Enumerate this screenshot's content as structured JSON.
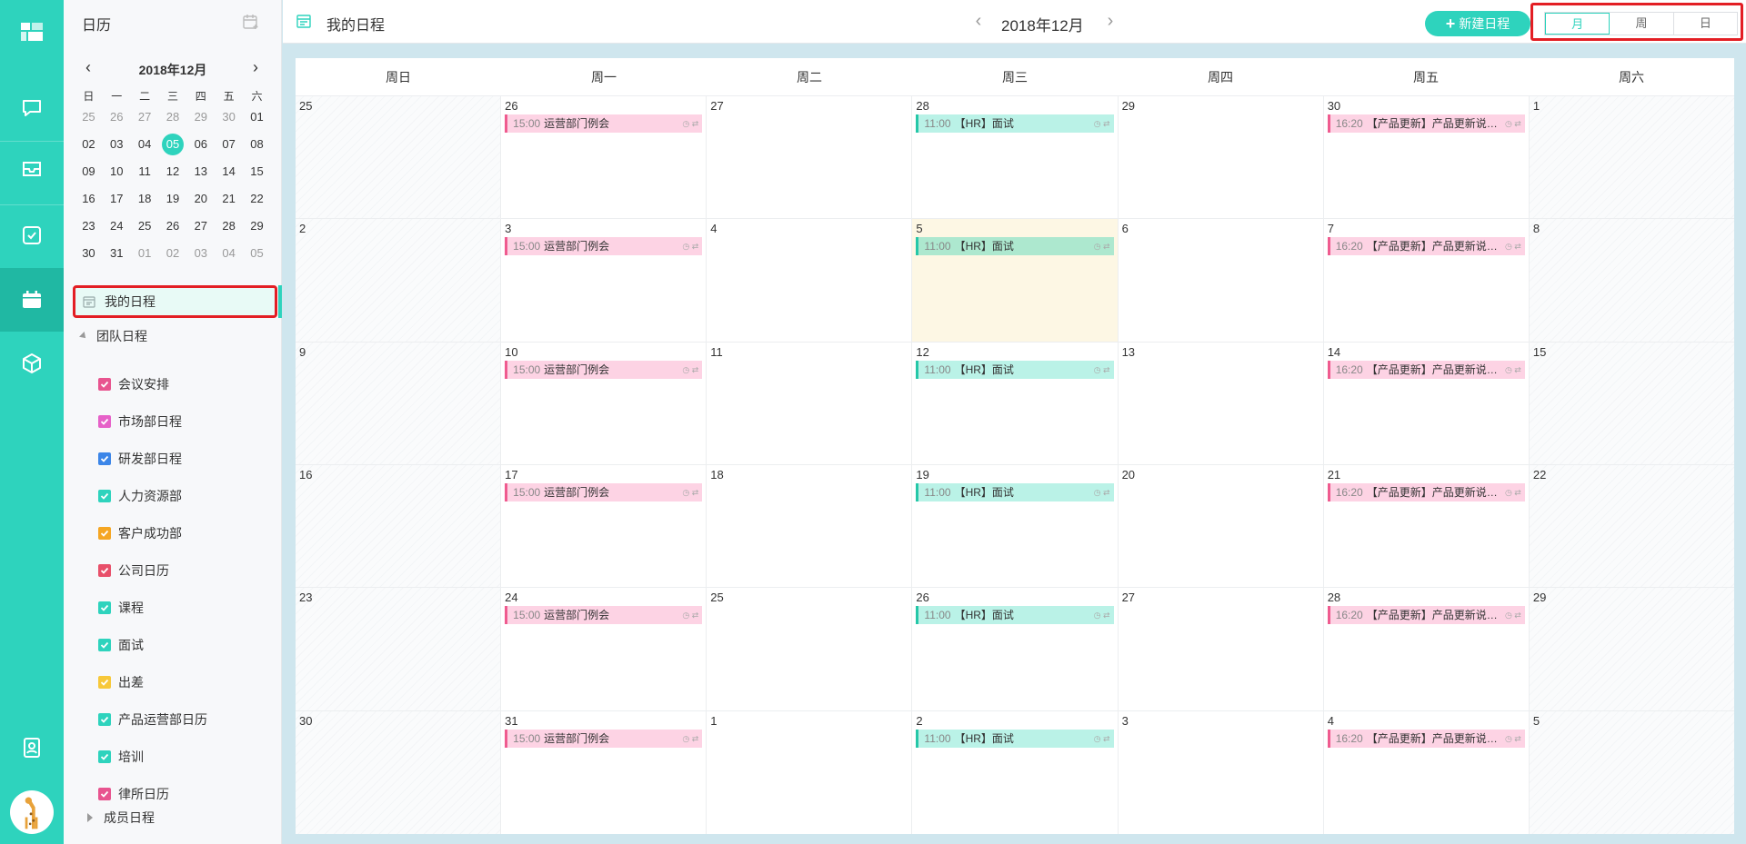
{
  "app": {
    "sidebar_title": "日历",
    "colors": {
      "accent": "#2ed3bd",
      "highlight_border": "#e31e24",
      "event_pink": "#fdd3e4",
      "event_teal": "#baf2e7",
      "today_bg": "#fdf7e4"
    }
  },
  "rail": {
    "icons": [
      "logo-icon",
      "chat-icon",
      "inbox-icon",
      "task-icon",
      "calendar-icon",
      "box-icon",
      "contacts-icon"
    ],
    "active": "calendar-icon"
  },
  "mini_calendar": {
    "title": "2018年12月",
    "weekdays": [
      "日",
      "一",
      "二",
      "三",
      "四",
      "五",
      "六"
    ],
    "weeks": [
      [
        "25",
        "26",
        "27",
        "28",
        "29",
        "30",
        "01"
      ],
      [
        "02",
        "03",
        "04",
        "05",
        "06",
        "07",
        "08"
      ],
      [
        "09",
        "10",
        "11",
        "12",
        "13",
        "14",
        "15"
      ],
      [
        "16",
        "17",
        "18",
        "19",
        "20",
        "21",
        "22"
      ],
      [
        "23",
        "24",
        "25",
        "26",
        "27",
        "28",
        "29"
      ],
      [
        "30",
        "31",
        "01",
        "02",
        "03",
        "04",
        "05"
      ]
    ],
    "today": "05"
  },
  "nav": {
    "my_schedule": "我的日程",
    "team_schedule": "团队日程",
    "member_schedule": "成员日程",
    "calendars": [
      {
        "label": "会议安排",
        "color": "#e8548f"
      },
      {
        "label": "市场部日程",
        "color": "#e661c8"
      },
      {
        "label": "研发部日程",
        "color": "#3c86e8"
      },
      {
        "label": "人力资源部",
        "color": "#2ed3bd"
      },
      {
        "label": "客户成功部",
        "color": "#f5a623"
      },
      {
        "label": "公司日历",
        "color": "#e8506a"
      },
      {
        "label": "课程",
        "color": "#2ed3bd"
      },
      {
        "label": "面试",
        "color": "#2ed3bd"
      },
      {
        "label": "出差",
        "color": "#f7c83a"
      },
      {
        "label": "产品运营部日历",
        "color": "#2ed3bd"
      },
      {
        "label": "培训",
        "color": "#2ed3bd"
      },
      {
        "label": "律所日历",
        "color": "#e8548f"
      }
    ]
  },
  "toolbar": {
    "title": "我的日程",
    "month": "2018年12月",
    "new_button": "新建日程",
    "views": [
      "月",
      "周",
      "日"
    ],
    "active_view": "月"
  },
  "calendar": {
    "weekdays": [
      "周日",
      "周一",
      "周二",
      "周三",
      "周四",
      "周五",
      "周六"
    ],
    "weeks": [
      [
        "25",
        "26",
        "27",
        "28",
        "29",
        "30",
        "1"
      ],
      [
        "2",
        "3",
        "4",
        "5",
        "6",
        "7",
        "8"
      ],
      [
        "9",
        "10",
        "11",
        "12",
        "13",
        "14",
        "15"
      ],
      [
        "16",
        "17",
        "18",
        "19",
        "20",
        "21",
        "22"
      ],
      [
        "23",
        "24",
        "25",
        "26",
        "27",
        "28",
        "29"
      ],
      [
        "30",
        "31",
        "1",
        "2",
        "3",
        "4",
        "5"
      ]
    ],
    "today": {
      "week": 1,
      "day": 3
    },
    "recurring_events": [
      {
        "weekday": 1,
        "time": "15:00",
        "title": "运营部门例会",
        "color": "pink"
      },
      {
        "weekday": 3,
        "time": "11:00",
        "title": "【HR】面试",
        "color": "teal"
      },
      {
        "weekday": 5,
        "time": "16:20",
        "title": "【产品更新】产品更新说明会",
        "color": "pink"
      }
    ]
  }
}
